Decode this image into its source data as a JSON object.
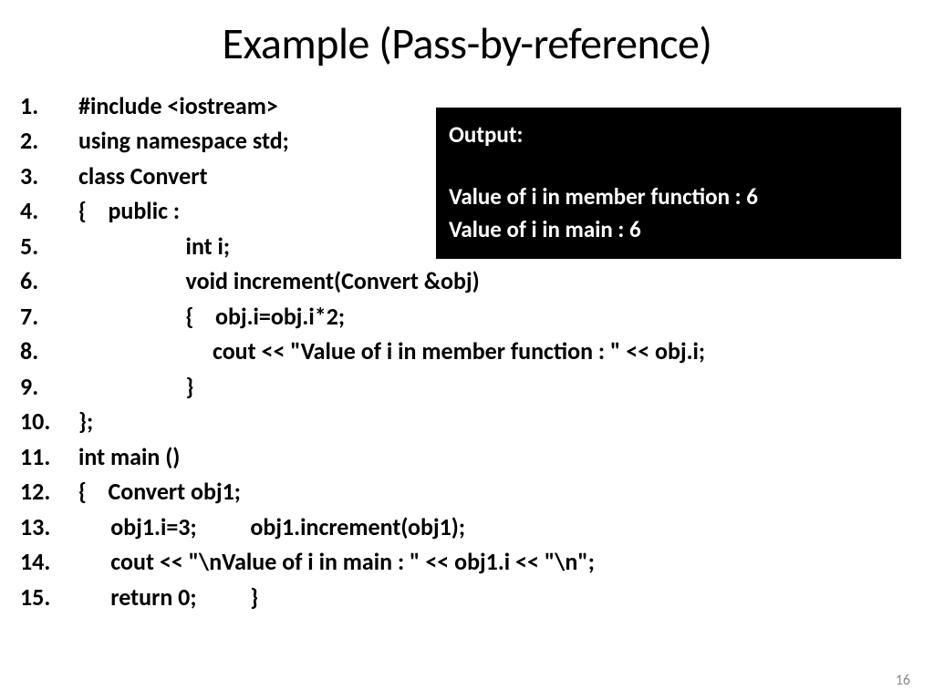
{
  "title": "Example (Pass-by-reference)",
  "code": [
    "#include <iostream>",
    "using namespace std;",
    "class Convert",
    "{    public :",
    "                    int i;",
    "                    void increment(Convert &obj)",
    "                    {    obj.i=obj.i*2;",
    "                         cout << \"Value of i in member function : \" << obj.i;",
    "                    }",
    "};",
    "int main ()",
    "{    Convert obj1;",
    "      obj1.i=3;          obj1.increment(obj1);",
    "      cout << \"\\nValue of i in main : \" << obj1.i << \"\\n\";",
    "      return 0;          }"
  ],
  "output": {
    "label": "Output:",
    "line1": "Value of i in member function : 6",
    "line2": "Value of i in main : 6"
  },
  "page_number": "16"
}
